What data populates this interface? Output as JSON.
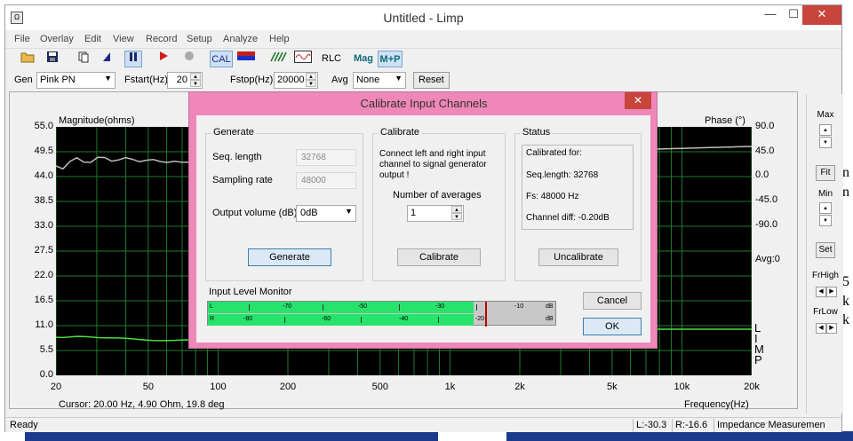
{
  "background": {
    "right_text": [
      "n",
      "n",
      "5",
      "k",
      "k"
    ]
  },
  "window": {
    "title": "Untitled - Limp",
    "app_icon": "limp-app-icon"
  },
  "menu": [
    "File",
    "Overlay",
    "Edit",
    "View",
    "Record",
    "Setup",
    "Analyze",
    "Help"
  ],
  "toolbar": {
    "cal_label": "CAL",
    "rlc_label": "RLC",
    "mag_label": "Mag",
    "mp_label": "M+P"
  },
  "genbar": {
    "gen_label": "Gen",
    "gen_value": "Pink PN",
    "fstart_label": "Fstart(Hz)",
    "fstart_value": "20",
    "fstop_label": "Fstop(Hz)",
    "fstop_value": "20000",
    "avg_label": "Avg",
    "avg_value": "None",
    "reset_label": "Reset"
  },
  "plot": {
    "left_axis_title": "Magnitude(ohms)",
    "right_axis_title": "Phase (°)",
    "x_axis_title": "Frequency(Hz)",
    "left_ticks": [
      "55.0",
      "49.5",
      "44.0",
      "38.5",
      "33.0",
      "27.5",
      "22.0",
      "16.5",
      "11.0",
      "5.5",
      "0.0"
    ],
    "right_ticks": [
      "90.0",
      "45.0",
      "0.0",
      "-45.0",
      "-90.0"
    ],
    "avg_readout": "Avg:0",
    "x_ticks": [
      "20",
      "50",
      "100",
      "200",
      "500",
      "1k",
      "2k",
      "5k",
      "10k",
      "20k"
    ],
    "cursor_readout": "Cursor: 20.00 Hz, 4.90 Ohm, 19.8 deg",
    "limp_letters": [
      "L",
      "I",
      "M",
      "P"
    ]
  },
  "right_panel": {
    "max_label": "Max",
    "fit_label": "Fit",
    "min_label": "Min",
    "set_label": "Set",
    "frhigh_label": "FrHigh",
    "frlow_label": "FrLow"
  },
  "statusbar": {
    "ready": "Ready",
    "left_level": "L:-30.3",
    "right_level": "R:-16.6",
    "mode": "Impedance Measuremen"
  },
  "dialog": {
    "title": "Calibrate Input Channels",
    "generate_group": "Generate",
    "seq_length_label": "Seq. length",
    "seq_length_value": "32768",
    "sampling_rate_label": "Sampling rate",
    "sampling_rate_value": "48000",
    "output_volume_label": "Output volume (dB)",
    "output_volume_value": "0dB",
    "generate_button": "Generate",
    "calibrate_group": "Calibrate",
    "calibrate_text": [
      "Connect left and right input",
      "channel  to  signal generator",
      "output !"
    ],
    "num_avg_label": "Number of averages",
    "num_avg_value": "1",
    "calibrate_button": "Calibrate",
    "status_group": "Status",
    "status_lines": [
      "Calibrated for:",
      "Seq.length: 32768",
      "Fs: 48000 Hz",
      "Channel diff: -0.20dB"
    ],
    "uncalibrate_button": "Uncalibrate",
    "level_monitor_label": "Input Level Monitor",
    "meter_scale": [
      "-70",
      "-60",
      "-50",
      "-40",
      "-30",
      "-20",
      "-10",
      "dB"
    ],
    "meter_left_label": "L",
    "meter_right_label": "R",
    "meter_left_scale": [
      "-70",
      "-60",
      "-50",
      "-30",
      "-10",
      "dB"
    ],
    "meter_right_scale": [
      "-80",
      "-60",
      "-40",
      "-20",
      "dB"
    ],
    "left_level_fraction": 0.76,
    "right_level_fraction": 0.76,
    "cancel_button": "Cancel",
    "ok_button": "OK"
  },
  "colors": {
    "plot_bg": "#000000",
    "grid": "#1f7a2e",
    "magnitude_curve": "#4ddc40",
    "phase_curve": "#bdbdbd",
    "dialog_frame": "#ef87b8",
    "meter_fill": "#28e36b"
  }
}
